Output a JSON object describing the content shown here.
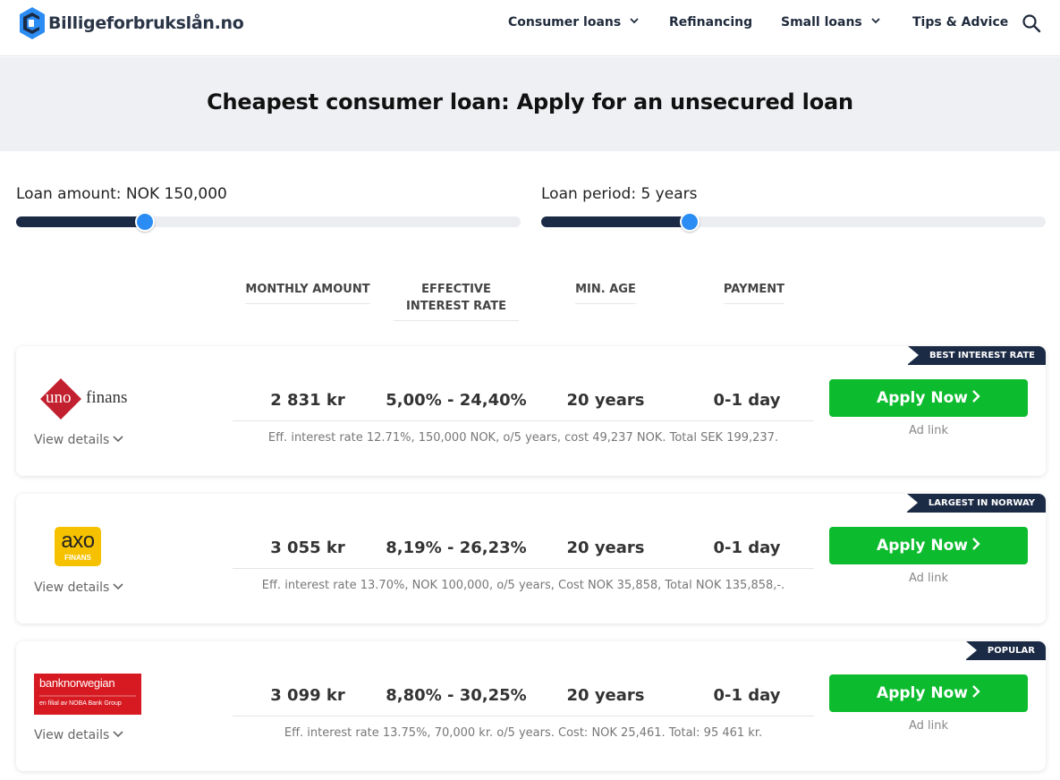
{
  "header": {
    "logo_text": "Billigeforbrukslån.no",
    "nav": [
      {
        "label": "Consumer loans",
        "has_dropdown": true
      },
      {
        "label": "Refinancing",
        "has_dropdown": false
      },
      {
        "label": "Small loans",
        "has_dropdown": true
      },
      {
        "label": "Tips & Advice",
        "has_dropdown": false
      }
    ],
    "search_icon": "search-icon"
  },
  "hero": {
    "title": "Cheapest consumer loan: Apply for an unsecured loan"
  },
  "sliders": {
    "amount": {
      "label": "Loan amount: NOK 150,000",
      "value_fraction": 0.255
    },
    "period": {
      "label": "Loan period: 5 years",
      "value_fraction": 0.295
    }
  },
  "columns": [
    "MONTHLY AMOUNT",
    "EFFECTIVE INTEREST RATE",
    "MIN. AGE",
    "PAYMENT"
  ],
  "offers": [
    {
      "ribbon": "BEST INTEREST RATE",
      "brand": "uno-finans",
      "logo_text_a": "uno",
      "logo_text_b": "finans",
      "view_details": "View details",
      "monthly": "2 831 kr",
      "rate": "5,00% - 24,40%",
      "min_age": "20 years",
      "payment": "0-1 day",
      "fineprint": "Eff. interest rate 12.71%, 150,000 NOK, o/5 years, cost 49,237 NOK. Total SEK 199,237.",
      "apply": "Apply Now",
      "adlink": "Ad link"
    },
    {
      "ribbon": "LARGEST IN NORWAY",
      "brand": "axo-finans",
      "logo_text_a": "axo",
      "logo_text_b": "FINANS",
      "view_details": "View details",
      "monthly": "3 055 kr",
      "rate": "8,19% - 26,23%",
      "min_age": "20 years",
      "payment": "0-1 day",
      "fineprint": "Eff. interest rate 13.70%, NOK 100,000, o/5 years, Cost NOK 35,858, Total NOK 135,858,-.",
      "apply": "Apply Now",
      "adlink": "Ad link"
    },
    {
      "ribbon": "POPULAR",
      "brand": "bank-norwegian",
      "logo_text_a": "banknorwegian",
      "logo_text_b": "en filial av NOBA Bank Group",
      "view_details": "View details",
      "monthly": "3 099 kr",
      "rate": "8,80% - 30,25%",
      "min_age": "20 years",
      "payment": "0-1 day",
      "fineprint": "Eff. interest rate 13.75%, 70,000 kr. o/5 years. Cost: NOK 25,461. Total: 95 461 kr.",
      "apply": "Apply Now",
      "adlink": "Ad link"
    }
  ],
  "colors": {
    "navy": "#1c2b45",
    "accent_blue": "#2b8cf3",
    "apply_green": "#0cbc2e",
    "hero_bg": "#eef0f4"
  }
}
